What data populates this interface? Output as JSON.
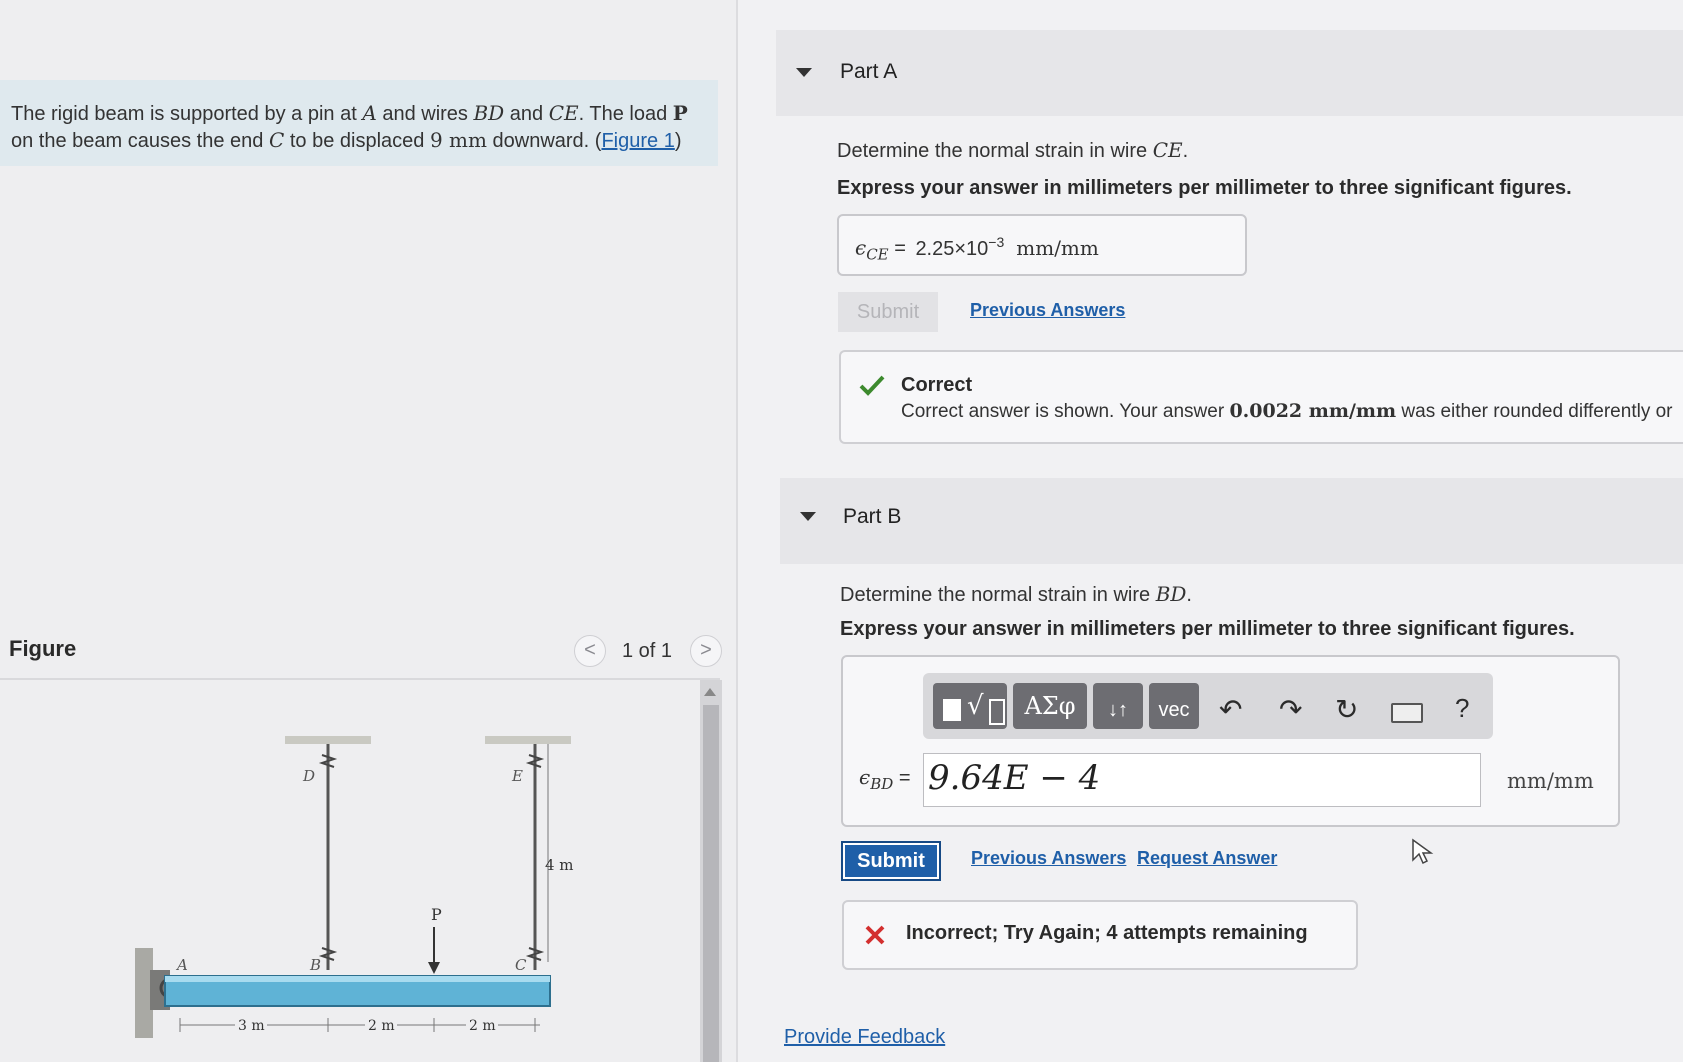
{
  "problem": {
    "t1": "The rigid beam is supported by a pin at ",
    "A": "A",
    "t2": " and wires ",
    "BD": "BD",
    "t3": " and ",
    "CE": "CE",
    "t4": ". The load ",
    "P": "P",
    "t5": " on the beam causes the end ",
    "C": "C",
    "t6": " to be displaced ",
    "disp": "9 mm",
    "t7": " downward. (",
    "figure_link": "Figure 1",
    "t8": ")"
  },
  "figure": {
    "label": "Figure",
    "count": "1 of 1",
    "prev_glyph": "<",
    "next_glyph": ">",
    "labels": {
      "A": "A",
      "B": "B",
      "C": "C",
      "D": "D",
      "E": "E",
      "P": "P",
      "len_wire": "4 m",
      "d1": "3 m",
      "d2": "2 m",
      "d3": "2 m"
    }
  },
  "partA": {
    "title": "Part A",
    "question_pre": "Determine the normal strain in wire ",
    "question_var": "CE",
    "question_post": ".",
    "instruction": "Express your answer in millimeters per millimeter to three significant figures.",
    "answer_symbol": "ϵ",
    "answer_sub": "CE",
    "answer_eq": " = ",
    "answer_value": "2.25×10",
    "answer_exp": "−3",
    "answer_unit": "mm/mm",
    "submit_label": "Submit",
    "previous_answers": "Previous Answers",
    "feedback_title": "Correct",
    "feedback_pre": "Correct answer is shown. Your answer ",
    "feedback_value": "0.0022 mm/mm",
    "feedback_post": " was either rounded differently or"
  },
  "partB": {
    "title": "Part B",
    "question_pre": "Determine the normal strain in wire ",
    "question_var": "BD",
    "question_post": ".",
    "instruction": "Express your answer in millimeters per millimeter to three significant figures.",
    "toolbar": {
      "templates_label": "√",
      "greek_label": "ΑΣφ",
      "updown_label": "↓↑",
      "vec_label": "vec",
      "help_label": "?"
    },
    "answer_symbol": "ϵ",
    "answer_sub": "BD",
    "answer_eq": " = ",
    "input_value": "9.64E − 4",
    "unit": "mm/mm",
    "submit_label": "Submit",
    "previous_answers": "Previous Answers",
    "request_answer": "Request Answer",
    "feedback": "Incorrect; Try Again; 4 attempts remaining"
  },
  "provide_feedback": "Provide Feedback",
  "colors": {
    "accent": "#1f5fa8",
    "correct": "#3d8a2e",
    "incorrect": "#d32f2f",
    "beam": "#5fb3d6"
  }
}
